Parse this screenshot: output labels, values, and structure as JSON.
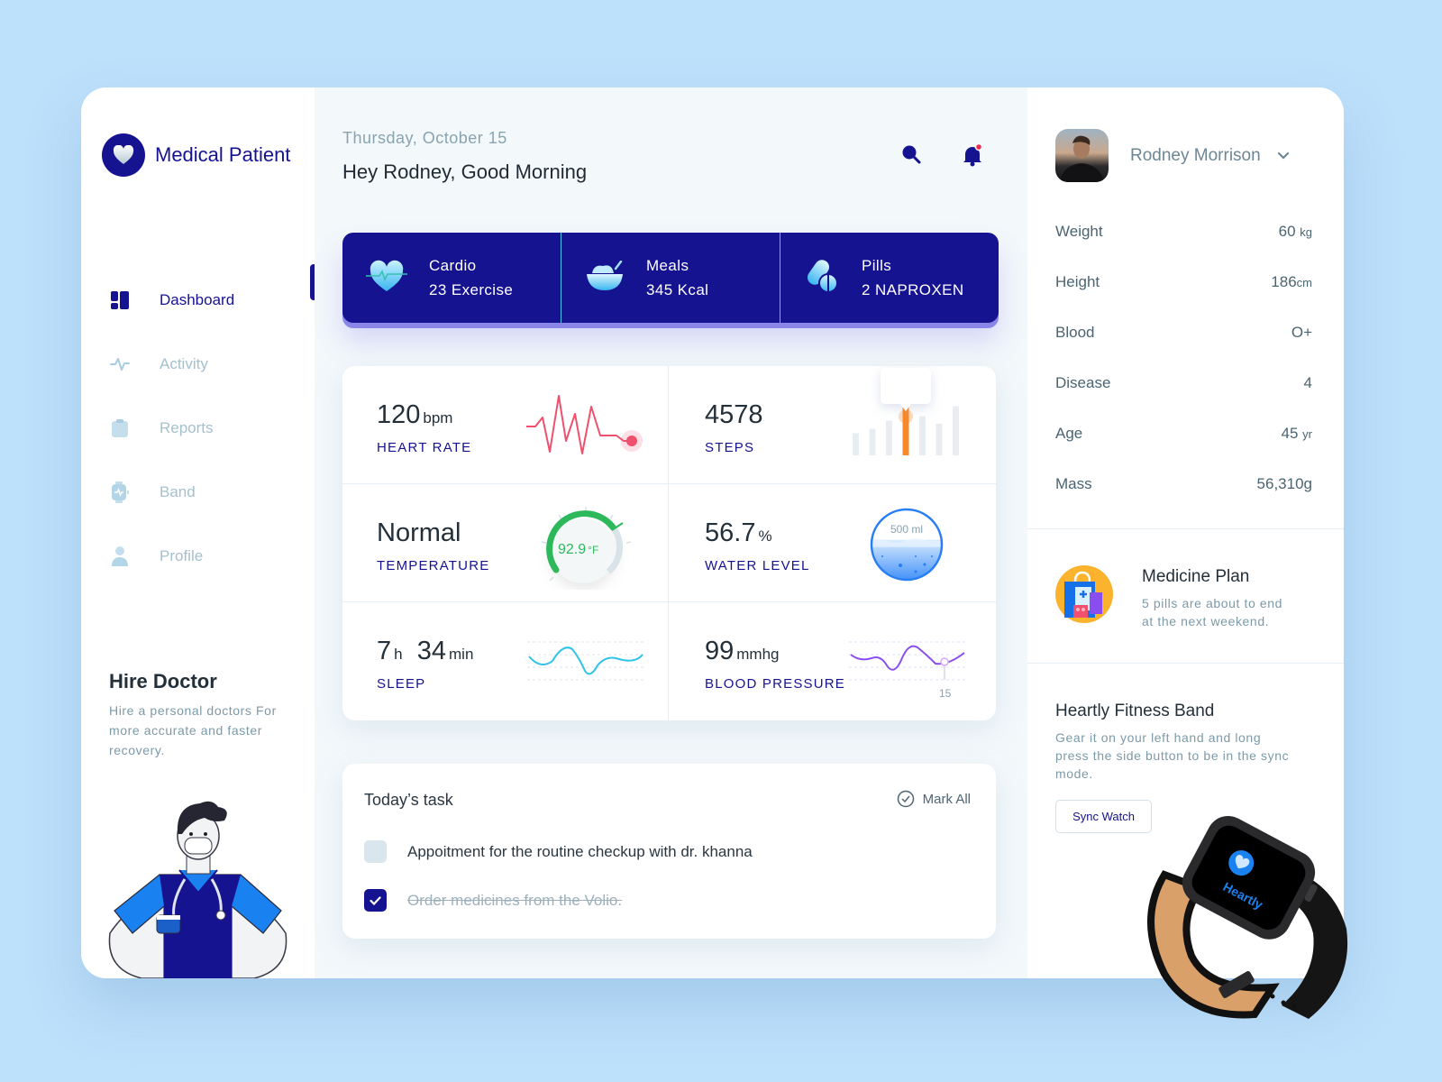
{
  "app": {
    "title": "Medical Patient"
  },
  "sidebar": {
    "items": [
      {
        "label": "Dashboard",
        "icon": "dashboard-icon",
        "active": true
      },
      {
        "label": "Activity",
        "icon": "activity-icon",
        "active": false
      },
      {
        "label": "Reports",
        "icon": "clipboard-icon",
        "active": false
      },
      {
        "label": "Band",
        "icon": "watch-icon",
        "active": false
      },
      {
        "label": "Profile",
        "icon": "user-icon",
        "active": false
      }
    ],
    "hire": {
      "title": "Hire Doctor",
      "description": "Hire a personal doctors For more accurate and faster recovery."
    }
  },
  "header": {
    "date": "Thursday, October 15",
    "greeting": "Hey Rodney, Good Morning",
    "notification_dot_color": "#f0294d"
  },
  "banner": [
    {
      "title": "Cardio",
      "value": "23 Exercise",
      "icon": "heart-pulse-icon"
    },
    {
      "title": "Meals",
      "value": "345 Kcal",
      "icon": "bowl-icon"
    },
    {
      "title": "Pills",
      "value": "2 NAPROXEN",
      "icon": "pills-icon"
    }
  ],
  "metrics": {
    "heart_rate": {
      "value": "120",
      "unit": "bpm",
      "label": "HEART RATE"
    },
    "steps": {
      "value": "4578",
      "unit": "",
      "label": "STEPS",
      "bars": [
        0.35,
        0.42,
        0.55,
        0.9,
        0.62,
        0.5,
        0.78
      ],
      "highlight_index": 3
    },
    "temperature": {
      "value": "Normal",
      "label": "TEMPERATURE",
      "reading": "92.9",
      "reading_unit": "°F"
    },
    "water": {
      "value": "56.7",
      "unit": "%",
      "label": "WATER LEVEL",
      "capacity": "500 ml",
      "fill_fraction": 0.567
    },
    "sleep": {
      "hours": "7",
      "hours_unit": "h",
      "minutes": "34",
      "minutes_unit": "min",
      "label": "SLEEP"
    },
    "blood_pressure": {
      "value": "99",
      "unit": "mmhg",
      "label": "BLOOD PRESSURE",
      "marker_label": "15"
    }
  },
  "tasks": {
    "title": "Today’s task",
    "mark_all": "Mark All",
    "items": [
      {
        "text": "Appoitment for the routine checkup with dr. khanna",
        "done": false
      },
      {
        "text": "Order medicines from the Volio.",
        "done": true
      }
    ]
  },
  "profile": {
    "name": "Rodney Morrison",
    "stats": [
      {
        "label": "Weight",
        "value": "60",
        "unit": "kg"
      },
      {
        "label": "Height",
        "value": "186",
        "unit": "cm"
      },
      {
        "label": "Blood",
        "value": "O+",
        "unit": ""
      },
      {
        "label": "Disease",
        "value": "4",
        "unit": ""
      },
      {
        "label": "Age",
        "value": "45",
        "unit": "yr"
      },
      {
        "label": "Mass",
        "value": "56,310",
        "unit": "g"
      }
    ]
  },
  "medicine_plan": {
    "title": "Medicine Plan",
    "description": "5 pills are about to end at the next weekend."
  },
  "fitness_band": {
    "title": "Heartly Fitness Band",
    "description": "Gear it on your left hand and long press the side button to be in the sync mode.",
    "button": "Sync Watch",
    "watch_screen_text": "Heartly"
  },
  "colors": {
    "brand": "#161391",
    "accent_cyan": "#4ec3f0",
    "heart": "#f0506e",
    "steps": "#f7892a",
    "temp": "#2eb85c",
    "water": "#2a7ef5",
    "sleep": "#2fc3e8",
    "bp": "#8a4ef0"
  }
}
